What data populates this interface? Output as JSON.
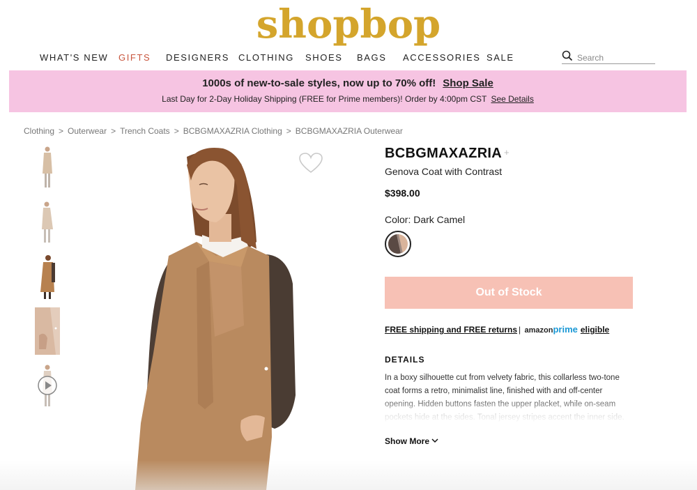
{
  "header": {
    "logo_text": "shopbop",
    "brand_color": "#D4A52C"
  },
  "nav": {
    "items": [
      {
        "label": "WHAT'S NEW",
        "highlighted": false
      },
      {
        "label": "GIFTS",
        "highlighted": true
      },
      {
        "label": "DESIGNERS",
        "highlighted": false
      },
      {
        "label": "CLOTHING",
        "highlighted": false
      },
      {
        "label": "SHOES",
        "highlighted": false
      },
      {
        "label": "BAGS",
        "highlighted": false
      },
      {
        "label": "ACCESSORIES",
        "highlighted": false
      },
      {
        "label": "SALE",
        "highlighted": false
      }
    ],
    "highlight_color": "#C8553D",
    "search_placeholder": "Search",
    "search_icon": "search-icon"
  },
  "promo": {
    "headline": "1000s of new-to-sale styles, now up to 70% off!",
    "cta": "Shop Sale",
    "subline": "Last Day for 2-Day Holiday Shipping (FREE for Prime members)! Order by 4:00pm CST",
    "details_link": "See Details",
    "bg_color": "#F6C4E2"
  },
  "breadcrumb": {
    "items": [
      "Clothing",
      "Outerwear",
      "Trench Coats",
      "BCBGMAXAZRIA Clothing",
      "BCBGMAXAZRIA Outerwear"
    ],
    "separator": ">"
  },
  "gallery": {
    "thumbnails": [
      "front-view",
      "side-view",
      "full-look",
      "detail-closeup",
      "video"
    ],
    "favorite_icon": "heart-icon",
    "play_icon": "play-icon"
  },
  "product": {
    "brand": "BCBGMAXAZRIA",
    "follow_symbol": "+",
    "name": "Genova Coat with Contrast",
    "price": "$398.00",
    "color_label": "Color: Dark Camel",
    "stock_button": "Out of Stock",
    "stock_button_color": "#F7C1B5"
  },
  "shipping": {
    "text": "FREE shipping and FREE returns",
    "separator": "|",
    "amazon_word": "amazon",
    "prime_word": "prime",
    "eligible": "eligible",
    "prime_color": "#1A98D5"
  },
  "details": {
    "heading": "DETAILS",
    "text": "In a boxy silhouette cut from velvety fabric, this collarless two-tone coat forms a retro, minimalist line, finished with and off-center opening. Hidden buttons fasten the upper placket, while on-seam pockets hide at the sides. Tonal jersey stripes accent the inner side.",
    "show_more": "Show More"
  }
}
